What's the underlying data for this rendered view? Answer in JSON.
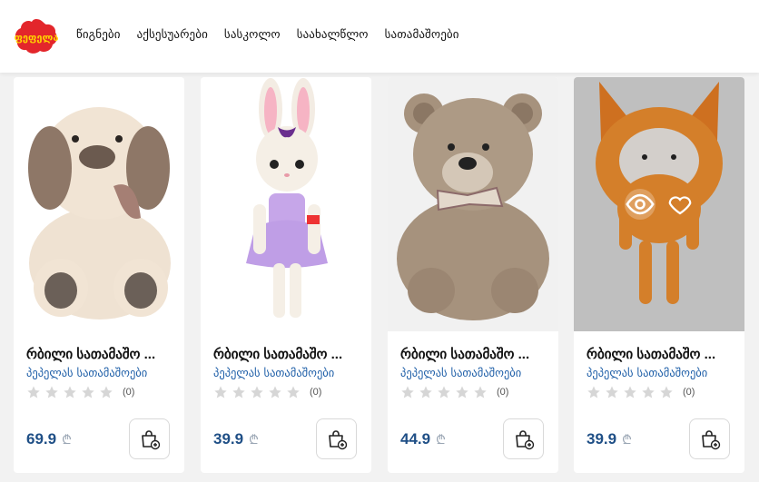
{
  "header": {
    "logo_text": "ფეფელა",
    "nav": [
      "წიგნები",
      "აქსესუარები",
      "სასკოლო",
      "საახალწლო",
      "სათამაშოები"
    ]
  },
  "products": [
    {
      "title": "რბილი სათამაშო ...",
      "brand": "პეპელას სათამაშოები",
      "rating_count": "(0)",
      "price": "69.9",
      "currency": "₾"
    },
    {
      "title": "რბილი სათამაშო ...",
      "brand": "პეპელას სათამაშოები",
      "rating_count": "(0)",
      "price": "39.9",
      "currency": "₾"
    },
    {
      "title": "რბილი სათამაშო ...",
      "brand": "პეპელას სათამაშოები",
      "rating_count": "(0)",
      "price": "44.9",
      "currency": "₾"
    },
    {
      "title": "რბილი სათამაშო ...",
      "brand": "პეპელას სათამაშოები",
      "rating_count": "(0)",
      "price": "39.9",
      "currency": "₾"
    }
  ],
  "product_images": [
    "plush-dog",
    "plush-bunny",
    "teddy-bear",
    "plush-fox"
  ],
  "icons": {
    "star": "star-icon",
    "cart": "cart-add-icon",
    "quick_view": "eye-icon",
    "wishlist": "heart-icon"
  },
  "colors": {
    "price": "#1f4f86",
    "brand": "#1f5fa8",
    "logo": "#e3262b",
    "star_empty": "#d6d6d6"
  }
}
